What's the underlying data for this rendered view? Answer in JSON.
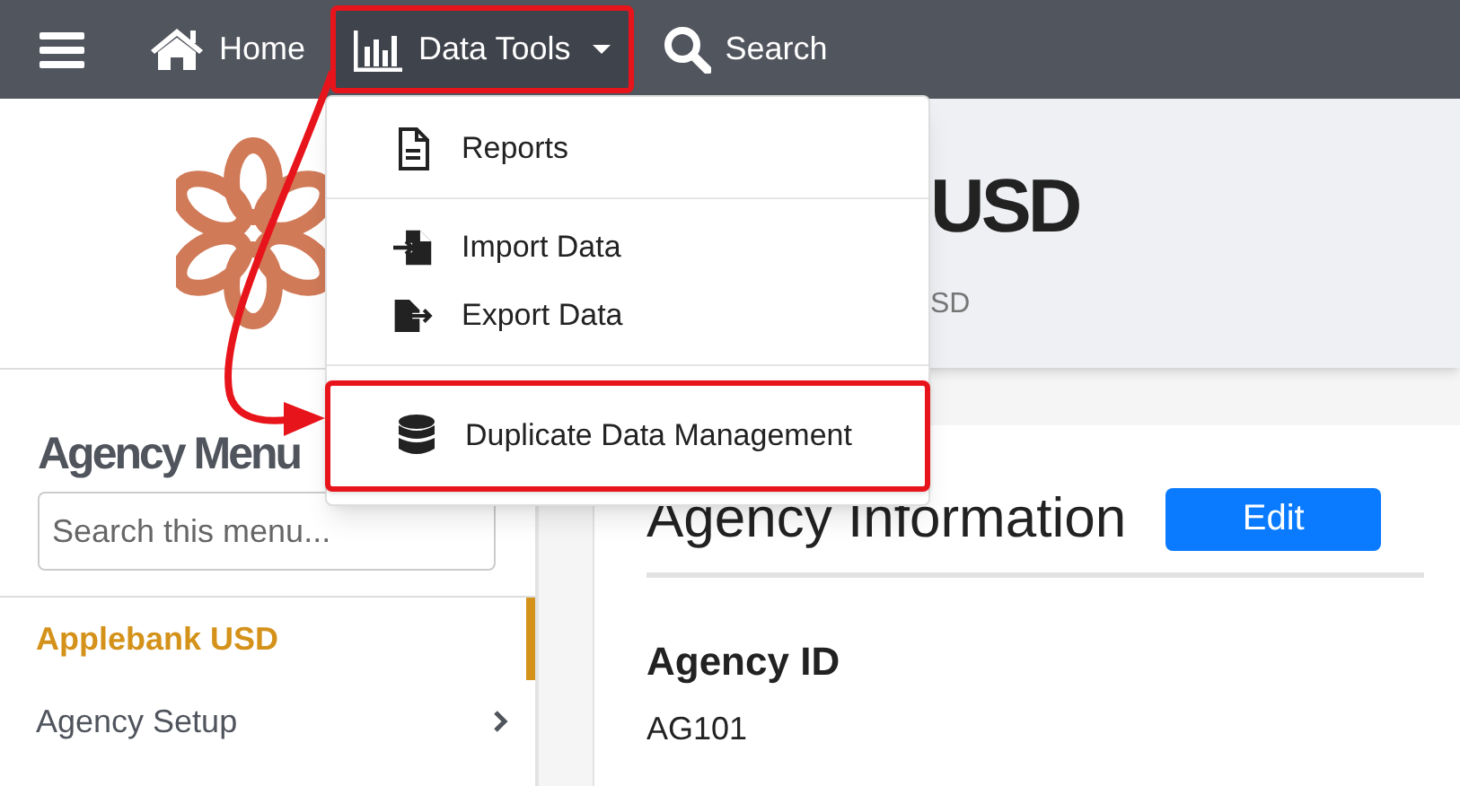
{
  "navbar": {
    "items": [
      {
        "kind": "menu"
      },
      {
        "kind": "home",
        "label": "Home"
      },
      {
        "kind": "dropdown",
        "label": "Data Tools",
        "expanded": true,
        "annotated": true
      },
      {
        "kind": "search",
        "label": "Search"
      }
    ]
  },
  "dropdown_menu": {
    "groups": [
      [
        {
          "kind": "reports",
          "label": "Reports",
          "annotated": false
        }
      ],
      [
        {
          "kind": "import",
          "label": "Import Data",
          "annotated": false
        },
        {
          "kind": "export",
          "label": "Export Data",
          "annotated": false
        }
      ],
      [
        {
          "kind": "database",
          "label": "Duplicate Data Management",
          "annotated": true
        }
      ]
    ]
  },
  "annotation_arrow": true,
  "sidebar": {
    "title": "Agency Menu",
    "search": {
      "placeholder": "Search this menu..."
    },
    "items": [
      {
        "label": "Applebank USD",
        "selected": true,
        "has_submenu": false
      },
      {
        "label": "Agency Setup",
        "selected": false,
        "has_submenu": true
      }
    ]
  },
  "header": {
    "title": "USD",
    "subtitle": "SD"
  },
  "content": {
    "heading": "Agency Information",
    "button": "Edit",
    "fields": [
      {
        "label": "Agency ID",
        "value": "AG101"
      }
    ]
  }
}
